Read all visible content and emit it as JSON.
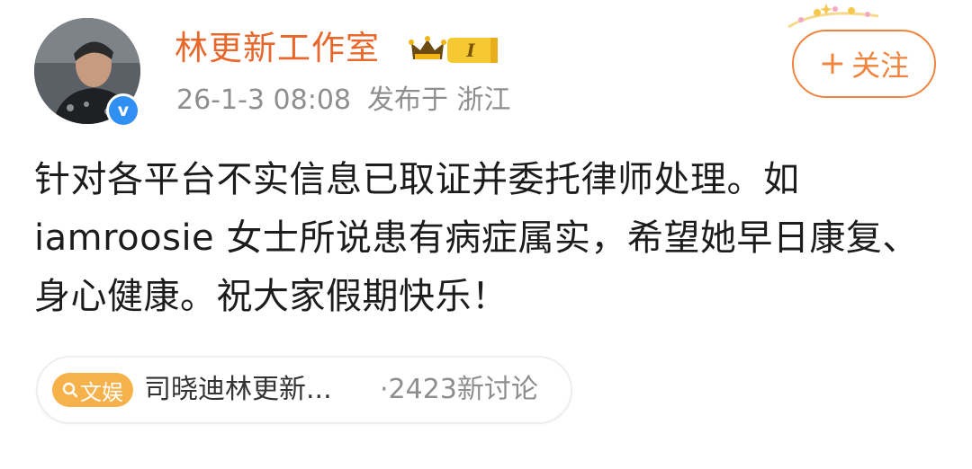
{
  "user": {
    "name": "林更新工作室",
    "member_level": "I",
    "verified_mark": "v"
  },
  "post_meta": {
    "time": "26-1-3 08:08",
    "location": "发布于 浙江"
  },
  "follow_button": {
    "label": "关注",
    "icon_glyph": "+"
  },
  "post": {
    "text": "针对各平台不实信息已取证并委托律师处理。如 iamroosie 女士所说患有病症属实，希望她早日康复、身心健康。祝大家假期快乐！"
  },
  "topic": {
    "tag_label": "文娱",
    "title": "司晓迪林更新...",
    "count": "·2423新讨论"
  },
  "colors": {
    "username": "#e8672b",
    "follow_accent": "#f0843d",
    "verified_blue": "#2f8ff2",
    "topic_tag": "#f7b14a",
    "meta_gray": "#8e8e8e"
  },
  "icons": {
    "avatar": "avatar-photo",
    "verified": "verified-icon",
    "member": "crown-icon",
    "follow": "plus-icon",
    "topic": "search-icon",
    "decoration": "sparkle-decoration-icon"
  }
}
